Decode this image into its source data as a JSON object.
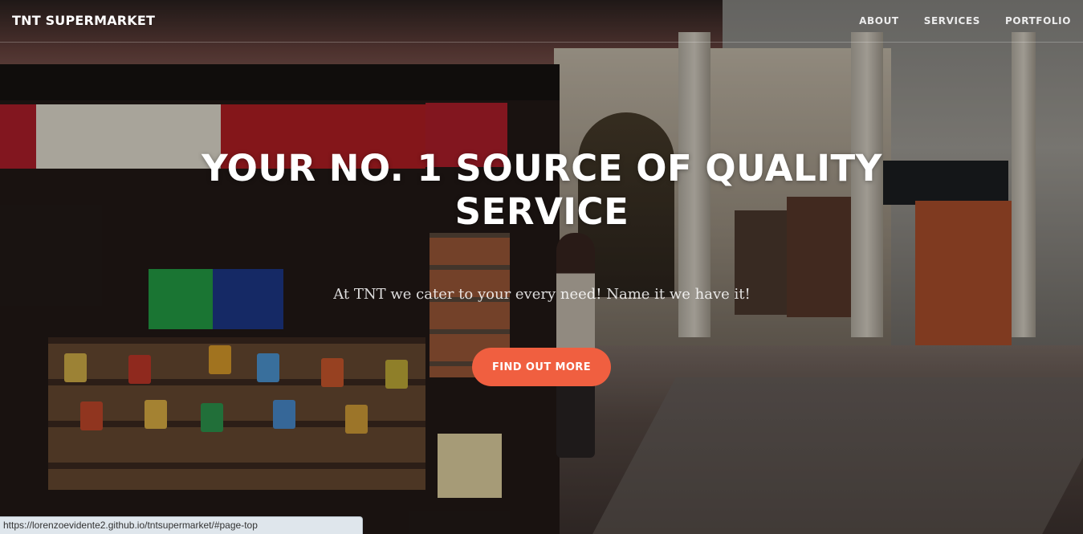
{
  "nav": {
    "brand": "TNT SUPERMARKET",
    "links": [
      {
        "label": "ABOUT"
      },
      {
        "label": "SERVICES"
      },
      {
        "label": "PORTFOLIO"
      }
    ]
  },
  "hero": {
    "title": "YOUR NO. 1 SOURCE OF QUALITY SERVICE",
    "subtitle": "At TNT we cater to your every need! Name it we have it!",
    "cta_label": "FIND OUT MORE"
  },
  "status_bar": {
    "url": "https://lorenzoevidente2.github.io/tntsupermarket/#page-top"
  },
  "colors": {
    "accent": "#f05f40",
    "text": "#ffffff"
  }
}
